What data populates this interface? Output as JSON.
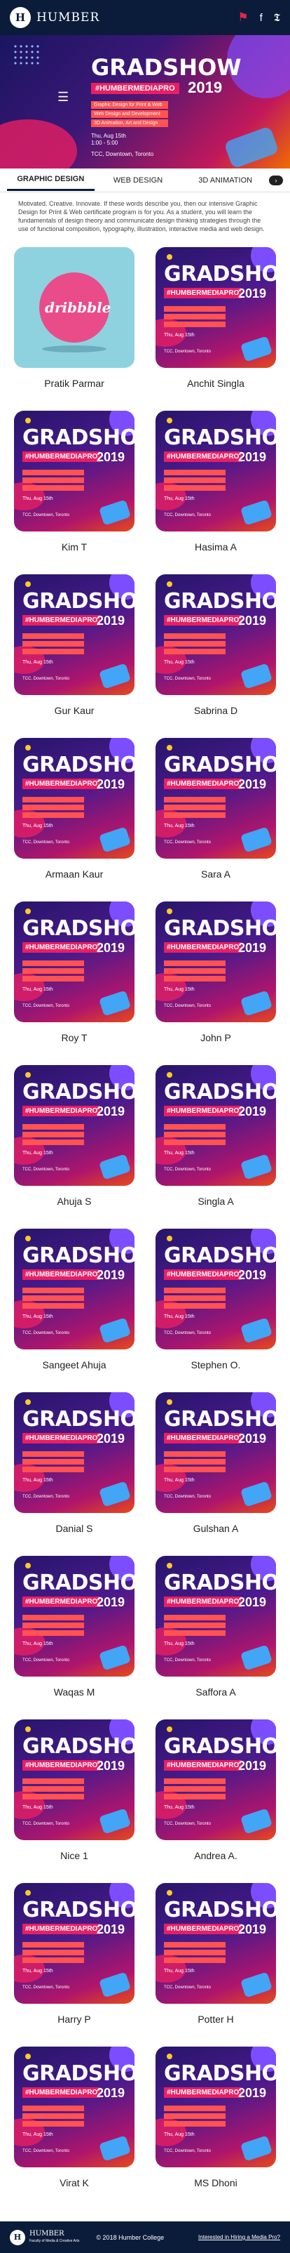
{
  "header": {
    "logo_mark": "H",
    "logo_text": "HUMBER"
  },
  "hero": {
    "title": "GRADSHOW",
    "hashtag": "#HUMBERMEDIAPRO",
    "year": "2019",
    "bullets": [
      "Graphic Design for Print & Web",
      "Web Design and Development",
      "3D Animation, Art and Design"
    ],
    "date": "Thu, Aug 15th",
    "time": "1:00 - 5:00",
    "location": "TCC, Downtown, Toronto"
  },
  "tabs": [
    "GRAPHIC DESIGN",
    "WEB DESIGN",
    "3D ANIMATION"
  ],
  "intro": "Motivated. Creative. Innovate. If these words describe you, then our intensive Graphic Design for Print & Web certificate program is for you. As a student, you will learn the fundamentals of design theory and communicate design thinking strategies through the use of functional composition, typography, illustration, interactive media and web design.",
  "thumb": {
    "title": "GRADSHOW",
    "hashtag": "#HUMBERMEDIAPRO",
    "year": "2019",
    "date": "Thu, Aug 15th",
    "location": "TCC, Downtown, Toronto"
  },
  "dribbble_text": "dribbble",
  "students": [
    "Pratik Parmar",
    "Anchit Singla",
    "Kim T",
    "Hasima A",
    "Gur Kaur",
    "Sabrina D",
    "Armaan Kaur",
    "Sara A",
    "Roy T",
    "John P",
    "Ahuja S",
    "Singla A",
    "Sangeet Ahuja",
    "Stephen O.",
    "Danial S",
    "Gulshan A",
    "Waqas M",
    "Saffora A",
    "Nice 1",
    "Andrea A.",
    "Harry P",
    "Potter H",
    "Virat K",
    "MS Dhoni"
  ],
  "footer": {
    "brand": "HUMBER",
    "brand_sub": "Faculty of Media & Creative Arts",
    "copyright": "© 2018 Humber College",
    "link": "Interested in Hiring a Media Pro?"
  }
}
